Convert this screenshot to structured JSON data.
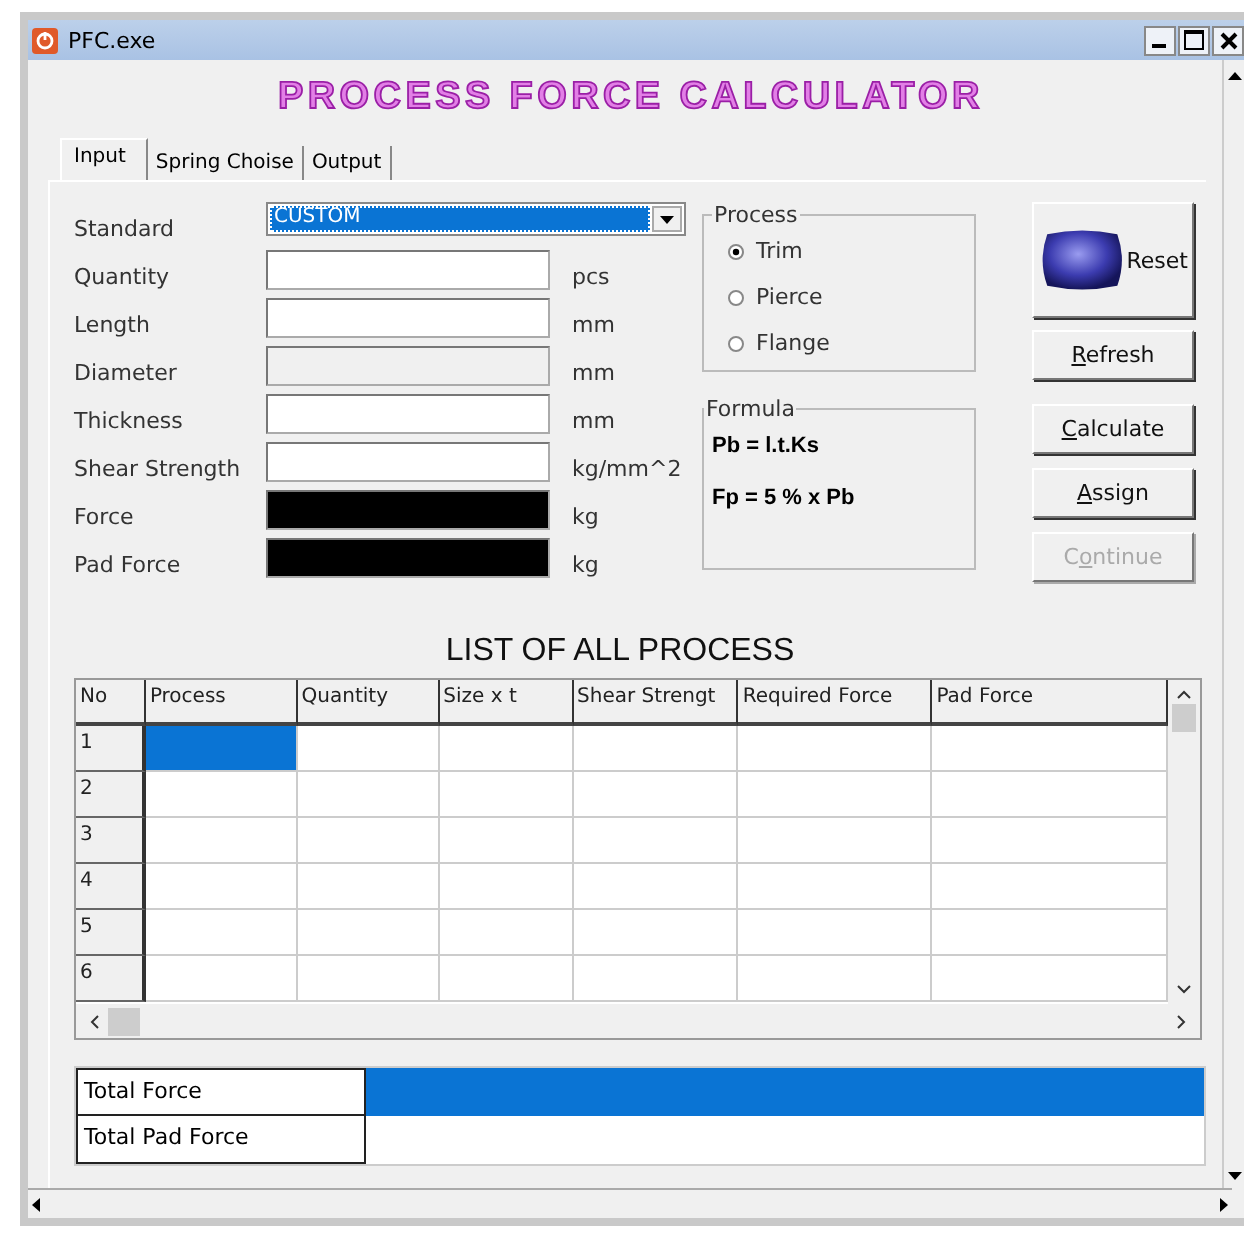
{
  "window": {
    "title": "PFC.exe"
  },
  "heading": "PROCESS FORCE CALCULATOR",
  "tabs": [
    {
      "label": "Input",
      "selected": true
    },
    {
      "label": "Spring Choise",
      "selected": false
    },
    {
      "label": "Output",
      "selected": false
    }
  ],
  "fields": [
    {
      "label": "Standard",
      "kind": "dropdown",
      "value": "CUSTOM"
    },
    {
      "label": "Quantity",
      "kind": "text",
      "unit": "pcs"
    },
    {
      "label": "Length",
      "kind": "text",
      "unit": "mm"
    },
    {
      "label": "Diameter",
      "kind": "disabled",
      "unit": "mm"
    },
    {
      "label": "Thickness",
      "kind": "text",
      "unit": "mm"
    },
    {
      "label": "Shear Strength",
      "kind": "text",
      "unit": "kg/mm^2"
    },
    {
      "label": "Force",
      "kind": "output",
      "unit": "kg"
    },
    {
      "label": "Pad Force",
      "kind": "output",
      "unit": "kg"
    }
  ],
  "process": {
    "title": "Process",
    "options": [
      {
        "label": "Trim",
        "selected": true
      },
      {
        "label": "Pierce",
        "selected": false
      },
      {
        "label": "Flange",
        "selected": false
      }
    ]
  },
  "formula": {
    "title": "Formula",
    "lines": [
      "Pb = l.t.Ks",
      "Fp = 5 % x Pb"
    ]
  },
  "buttons": [
    {
      "label": "Reset",
      "kind": "image",
      "disabled": false
    },
    {
      "kind": "text",
      "parts": [
        {
          "text": "R",
          "underline": true
        },
        {
          "text": "efresh",
          "underline": false
        }
      ],
      "disabled": false
    },
    {
      "kind": "text",
      "parts": [
        {
          "text": "C",
          "underline": true
        },
        {
          "text": "alculate",
          "underline": false
        }
      ],
      "disabled": false
    },
    {
      "kind": "text",
      "parts": [
        {
          "text": "A",
          "underline": true
        },
        {
          "text": "ssign",
          "underline": false
        }
      ],
      "disabled": false
    },
    {
      "kind": "text",
      "parts": [
        {
          "text": "C",
          "underline": false
        },
        {
          "text": "o",
          "underline": true
        },
        {
          "text": "ntinue",
          "underline": false
        }
      ],
      "disabled": true
    }
  ],
  "table": {
    "title": "LIST OF ALL PROCESS",
    "columns": [
      "No",
      "Process",
      "Quantity",
      "Size x t",
      "Shear Strengt",
      "Required Force",
      "Pad Force"
    ],
    "rows": [
      {
        "number": "1",
        "selected": true
      },
      {
        "number": "2",
        "selected": false
      },
      {
        "number": "3",
        "selected": false
      },
      {
        "number": "4",
        "selected": false
      },
      {
        "number": "5",
        "selected": false
      },
      {
        "number": "6",
        "selected": false
      }
    ]
  },
  "totals": [
    {
      "label": "Total Force",
      "selected": true
    },
    {
      "label": "Total Pad Force",
      "selected": false
    }
  ]
}
